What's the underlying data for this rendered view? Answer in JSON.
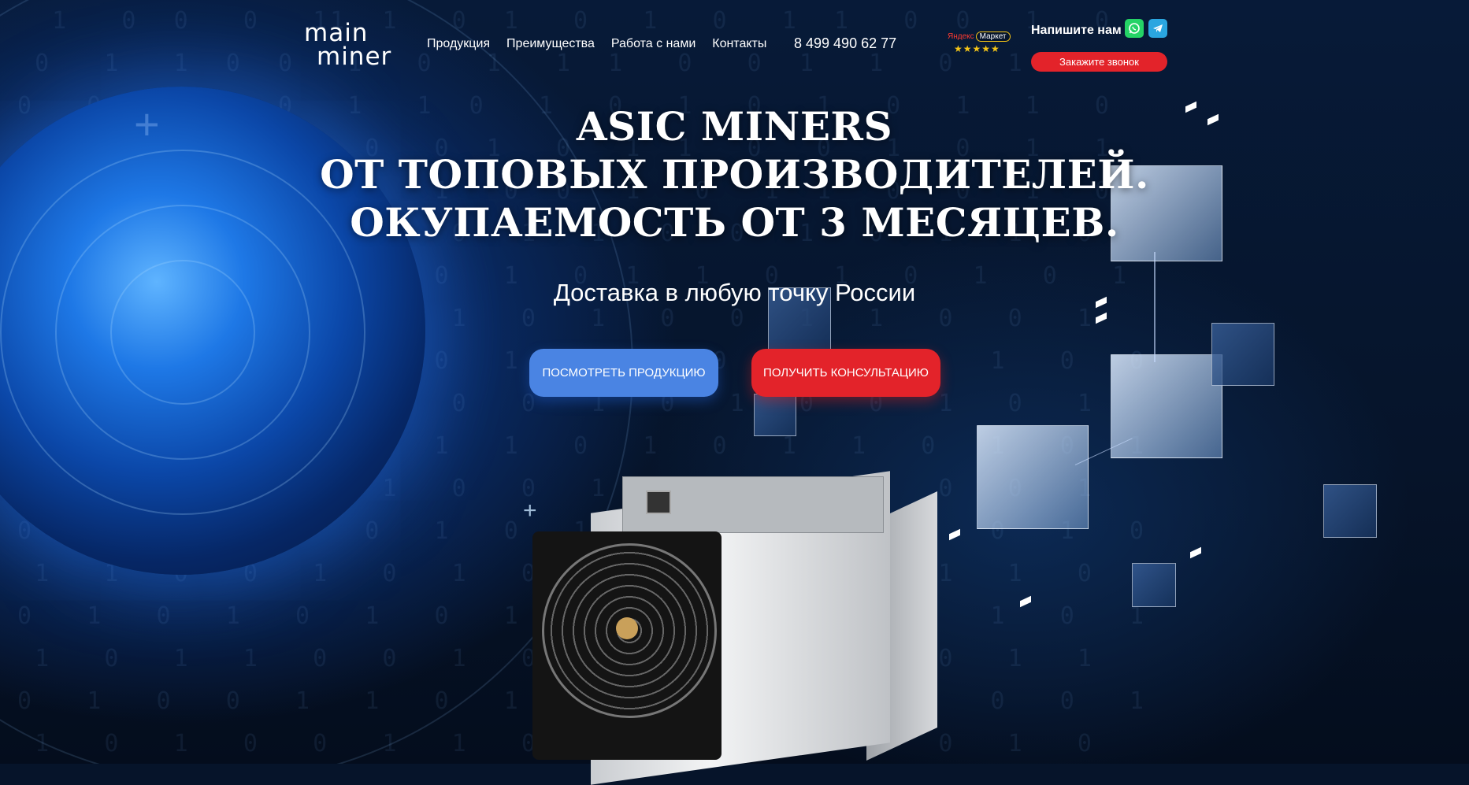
{
  "header": {
    "logo": {
      "line1": "main",
      "line2": "miner"
    },
    "nav": [
      "Продукция",
      "Преимущества",
      "Работа с нами",
      "Контакты"
    ],
    "phone": "8 499 490 62 77",
    "yandex": {
      "brand": "Яндекс",
      "market": "Маркет",
      "stars": "★★★★★"
    },
    "write_us": "Напишите нам",
    "messenger_icons": [
      "whatsapp-icon",
      "telegram-icon"
    ],
    "call_button": "Закажите звонок"
  },
  "hero": {
    "title_lines": [
      "ASIC MINERS",
      "ОТ ТОПОВЫХ ПРОИЗВОДИТЕЛЕЙ.",
      "ОКУПАЕМОСТЬ ОТ 3 МЕСЯЦЕВ."
    ],
    "subtitle": "Доставка в любую точку России",
    "btn_products": "Посмотреть продукцию",
    "btn_consult": "Получить консультацию"
  },
  "colors": {
    "accent_red": "#e3232a",
    "accent_blue": "#4a84e3",
    "background": "#06142a"
  }
}
